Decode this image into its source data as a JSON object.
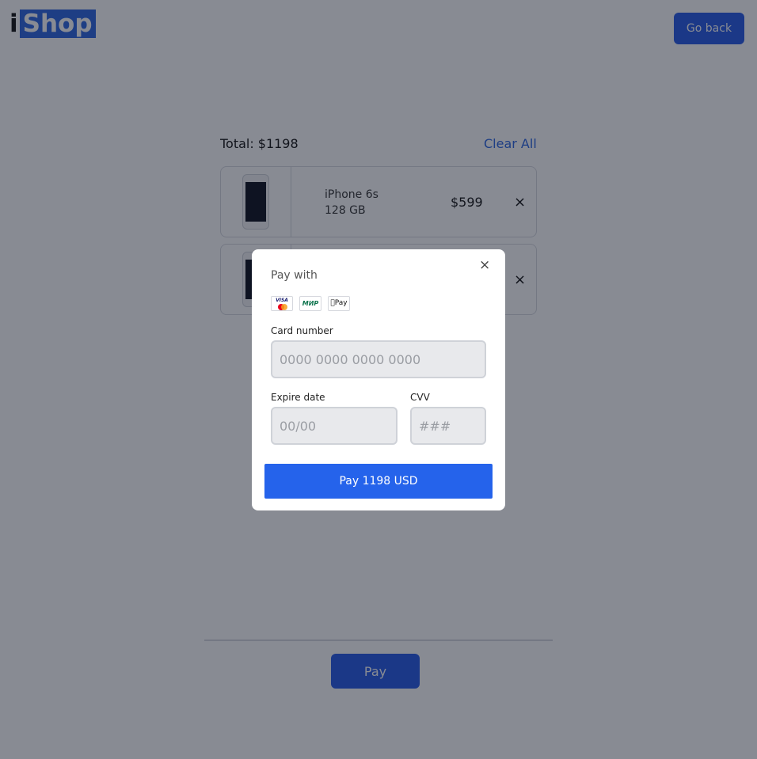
{
  "header": {
    "logo_prefix": "i",
    "logo_main": "Shop",
    "go_back_label": "Go back"
  },
  "cart": {
    "total_label": "Total:",
    "total_value": "$1198",
    "clear_all_label": "Clear All",
    "items": [
      {
        "name": "iPhone 6s",
        "storage": "128 GB",
        "price": "$599",
        "remove": "×"
      },
      {
        "name": "",
        "storage": "",
        "price": "",
        "remove": "×"
      }
    ],
    "pay_label": "Pay"
  },
  "payment_modal": {
    "close": "×",
    "pay_with_label": "Pay with",
    "methods": [
      {
        "icon": "visa-mastercard-icon",
        "text": "VISA"
      },
      {
        "icon": "mir-icon",
        "text": "МИР"
      },
      {
        "icon": "apple-pay-icon",
        "text": "Pay"
      }
    ],
    "card_number_label": "Card number",
    "card_number_placeholder": "0000 0000 0000 0000",
    "expire_label": "Expire date",
    "expire_placeholder": "00/00",
    "cvv_label": "CVV",
    "cvv_placeholder": "###",
    "pay_button_label": "Pay 1198 USD"
  },
  "colors": {
    "accent": "#2563eb",
    "overlay": "rgba(17,24,39,0.5)"
  }
}
